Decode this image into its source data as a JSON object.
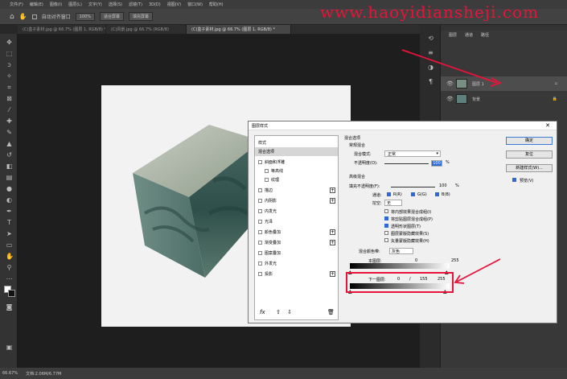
{
  "watermark_url": "www.haoyidiansheji.com",
  "menu": [
    "文件(F)",
    "编辑(E)",
    "图像(I)",
    "图层(L)",
    "文字(Y)",
    "选择(S)",
    "滤镜(T)",
    "3D(D)",
    "视图(V)",
    "窗口(W)",
    "帮助(H)"
  ],
  "options": {
    "auto_select": "自动对齐窗口",
    "zoom": "100%",
    "fit": "适合屏幕",
    "fill": "填充屏幕"
  },
  "tabs": [
    "(C)盒子素材.jpg @ 66.7% (图层 1, RGB/8) *",
    "(C)风景.jpg @ 66.7% (RGB/8)",
    "(C)盒子素材.jpg @ 66.7% (图层 1, RGB/8) *"
  ],
  "layers_panel": {
    "tabs": [
      "图层",
      "通道",
      "路径"
    ],
    "layers": [
      {
        "name": "图层 1",
        "selected": true
      },
      {
        "name": "背景",
        "locked": true
      }
    ]
  },
  "status": {
    "zoom": "66.67%",
    "doc": "文档:2.06M/6.77M"
  },
  "dialog": {
    "title": "图层样式",
    "close_icon": "close-icon",
    "styles": [
      {
        "label": "样式",
        "checkbox": false
      },
      {
        "label": "混合选项",
        "checkbox": false,
        "selected": true
      },
      {
        "label": "斜面和浮雕",
        "checkbox": true
      },
      {
        "label": "等高线",
        "checkbox": true,
        "indent": true
      },
      {
        "label": "纹理",
        "checkbox": true,
        "indent": true
      },
      {
        "label": "描边",
        "checkbox": true,
        "plus": true
      },
      {
        "label": "内阴影",
        "checkbox": true,
        "plus": true
      },
      {
        "label": "内发光",
        "checkbox": true
      },
      {
        "label": "光泽",
        "checkbox": true
      },
      {
        "label": "颜色叠加",
        "checkbox": true,
        "plus": true
      },
      {
        "label": "渐变叠加",
        "checkbox": true,
        "plus": true
      },
      {
        "label": "图案叠加",
        "checkbox": true
      },
      {
        "label": "外发光",
        "checkbox": true
      },
      {
        "label": "投影",
        "checkbox": true,
        "plus": true
      }
    ],
    "blend_options_title": "混合选项",
    "general_blend": "常规混合",
    "blend_mode_label": "混合模式:",
    "blend_mode_value": "正常",
    "opacity_label": "不透明度(O):",
    "opacity_value": "100",
    "percent": "%",
    "advanced_blend": "高级混合",
    "fill_opacity_label": "填充不透明度(F):",
    "fill_opacity_value": "100",
    "channels_label": "通道:",
    "channel_r": "R(R)",
    "channel_g": "G(G)",
    "channel_b": "B(B)",
    "knockout_label": "挖空:",
    "knockout_value": "无",
    "adv_checks": [
      {
        "label": "将内部效果混合成组(I)",
        "checked": false
      },
      {
        "label": "将剪贴图层混合成组(P)",
        "checked": true
      },
      {
        "label": "透明形状图层(T)",
        "checked": true
      },
      {
        "label": "图层蒙版隐藏效果(S)",
        "checked": false
      },
      {
        "label": "矢量蒙版隐藏效果(H)",
        "checked": false
      }
    ],
    "blend_if_label": "混合颜色带:",
    "blend_if_value": "灰色",
    "this_layer_label": "本图层:",
    "this_layer_values": [
      "0",
      "255"
    ],
    "underlying_label": "下一图层:",
    "underlying_values": [
      "0",
      "/",
      "155",
      "255"
    ],
    "buttons": [
      "确定",
      "复位",
      "新建样式(W)...",
      "预览(V)"
    ],
    "preview_checked": true,
    "footer_icons": [
      "fx-icon",
      "move-up-icon",
      "move-down-icon",
      "trash-icon"
    ]
  },
  "colors": {
    "accent": "#e8133a",
    "selection": "#2d6ad8"
  }
}
